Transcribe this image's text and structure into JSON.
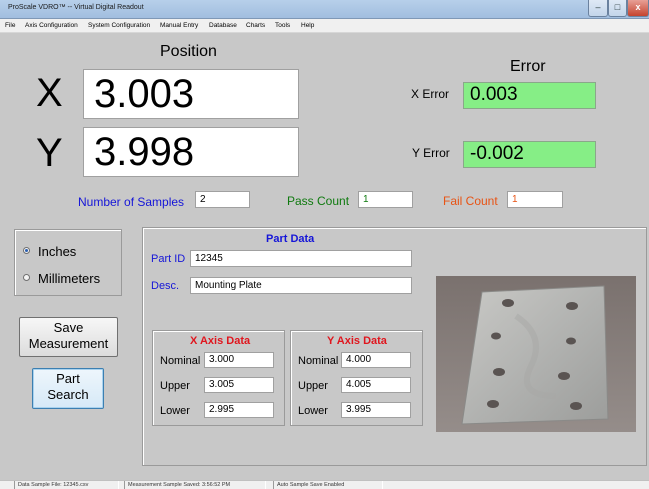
{
  "window": {
    "title": "ProScale VDRO™ -- Virtual Digital Readout",
    "controls": {
      "minimize": "–",
      "maximize": "□",
      "close": "x"
    }
  },
  "menu": [
    "File",
    "Axis Configuration",
    "System Configuration",
    "Manual Entry",
    "Database",
    "Charts",
    "Tools",
    "Help"
  ],
  "position": {
    "title": "Position",
    "x_label": "X",
    "x_value": "3.003",
    "y_label": "Y",
    "y_value": "3.998"
  },
  "error": {
    "title": "Error",
    "x_label": "X Error",
    "x_value": "0.003",
    "y_label": "Y Error",
    "y_value": "-0.002",
    "ok_color": "#86ee86"
  },
  "counts": {
    "samples_label": "Number of Samples",
    "samples_value": "2",
    "pass_label": "Pass Count",
    "pass_value": "1",
    "fail_label": "Fail Count",
    "fail_value": "1"
  },
  "units": {
    "options": [
      "Inches",
      "Millimeters"
    ],
    "selected": "Inches"
  },
  "buttons": {
    "save_line1": "Save",
    "save_line2": "Measurement",
    "search_line1": "Part",
    "search_line2": "Search"
  },
  "part": {
    "title": "Part Data",
    "id_label": "Part ID",
    "id_value": "12345",
    "desc_label": "Desc.",
    "desc_value": "Mounting Plate"
  },
  "x_axis": {
    "title": "X Axis Data",
    "nominal_label": "Nominal",
    "nominal_value": "3.000",
    "upper_label": "Upper",
    "upper_value": "3.005",
    "lower_label": "Lower",
    "lower_value": "2.995"
  },
  "y_axis": {
    "title": "Y Axis Data",
    "nominal_label": "Nominal",
    "nominal_value": "4.000",
    "upper_label": "Upper",
    "upper_value": "4.005",
    "lower_label": "Lower",
    "lower_value": "3.995"
  },
  "status": {
    "file": "Data Sample File: 12345.csv",
    "saved": "Measurement Sample Saved: 3:56:52 PM",
    "auto": "Auto Sample Save Enabled"
  },
  "colors": {
    "label_blue": "#1515d8",
    "pass_green": "#0f7a0f",
    "fail_orange": "#e85314",
    "axis_red": "#e0161e"
  }
}
